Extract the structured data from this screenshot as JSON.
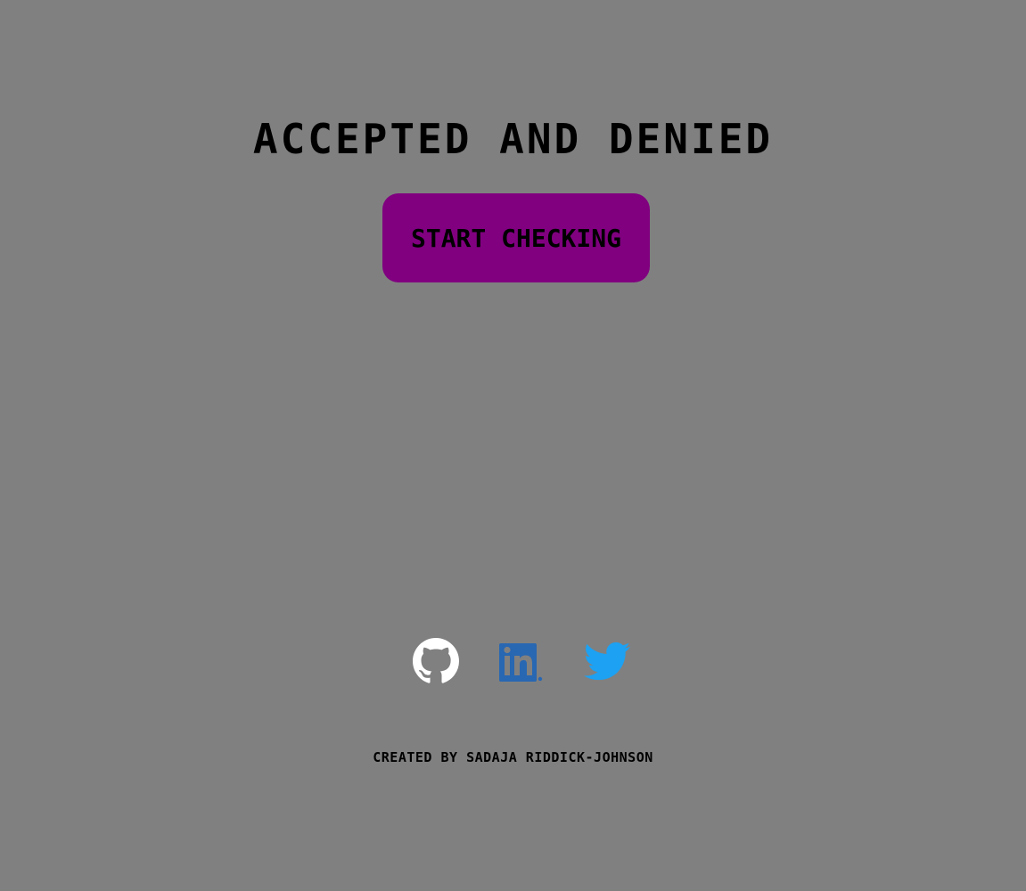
{
  "page": {
    "title": "ACCEPTED AND DENIED",
    "start_button_label": "START CHECKING",
    "credit": "CREATED BY SADAJA RIDDICK-JOHNSON"
  },
  "socials": [
    {
      "name": "github",
      "icon": "github-icon",
      "color": "#ffffff"
    },
    {
      "name": "linkedin",
      "icon": "linkedin-icon",
      "color": "#2867b2"
    },
    {
      "name": "twitter",
      "icon": "twitter-icon",
      "color": "#1da1f2"
    }
  ],
  "colors": {
    "background": "#808080",
    "button": "#800080",
    "text": "#000000"
  }
}
